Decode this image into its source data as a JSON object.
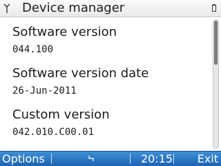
{
  "header": {
    "title": "Device manager",
    "signal_icon": "signal-antenna-icon",
    "battery_icon": "battery-icon"
  },
  "items": [
    {
      "label": "Software version",
      "value": "044.100"
    },
    {
      "label": "Software version date",
      "value": "26-Jun-2011"
    },
    {
      "label": "Custom version",
      "value": "042.010.C00.01"
    }
  ],
  "softkeys": {
    "left": "Options",
    "clock": "20:15",
    "right": "Exit",
    "center_icon": "sync-icon"
  },
  "colors": {
    "softkey_bar": "#2a76c6",
    "title_bar": "#f2f2f2"
  }
}
